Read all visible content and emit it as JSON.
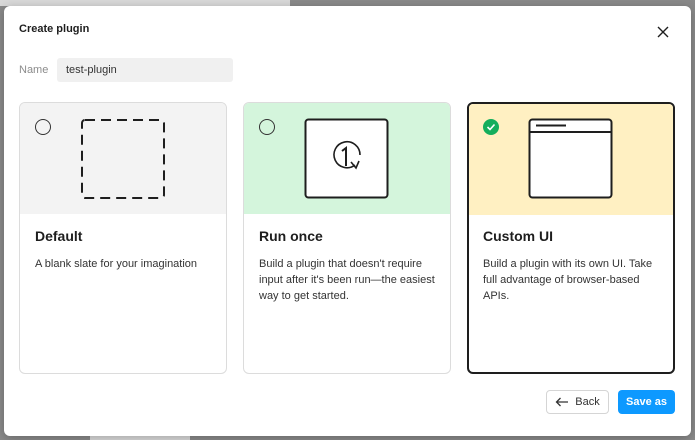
{
  "dialog": {
    "title": "Create plugin",
    "name_label": "Name",
    "name_value": "test-plugin"
  },
  "options": [
    {
      "title": "Default",
      "description": "A blank slate for your imagination",
      "selected": false,
      "hero_color": "#f3f3f3",
      "icon": "dashed-square-icon"
    },
    {
      "title": "Run once",
      "description": "Build a plugin that doesn't require input after it's been run—the easiest way to get started.",
      "selected": false,
      "hero_color": "#d4f5dc",
      "icon": "run-once-icon"
    },
    {
      "title": "Custom UI",
      "description": "Build a plugin with its own UI. Take full advantage of browser-based APIs.",
      "selected": true,
      "hero_color": "#fff0c2",
      "icon": "window-icon"
    }
  ],
  "footer": {
    "back_label": "Back",
    "save_label": "Save as"
  },
  "colors": {
    "primary": "#0d99ff",
    "check": "#14ae5c"
  }
}
